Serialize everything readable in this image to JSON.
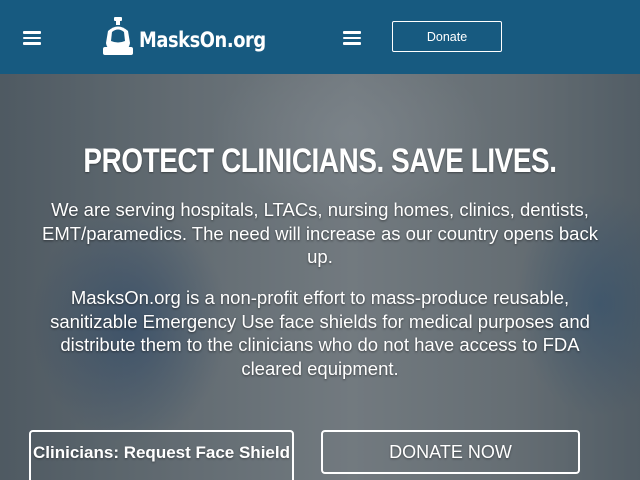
{
  "header": {
    "logo_text": "MasksOn.org",
    "donate_label": "Donate",
    "colors": {
      "background": "#175a80",
      "text": "#ffffff"
    },
    "icons": [
      "hamburger-menu-icon",
      "mask-logo-icon"
    ]
  },
  "hero": {
    "title": "PROTECT CLINICIANS. SAVE LIVES.",
    "paragraph_1": "We are serving hospitals, LTACs, nursing homes, clinics, dentists, EMT/paramedics. The need will increase as our country opens back up.",
    "paragraph_2": "MasksOn.org is a non-profit effort to mass-produce reusable, sanitizable Emergency Use face shields for medical purposes and distribute them to the clinicians who do not have access to FDA cleared equipment.",
    "buttons": {
      "request_label": "Clinicians: Request Face Shield",
      "donate_label": "DONATE NOW"
    }
  }
}
